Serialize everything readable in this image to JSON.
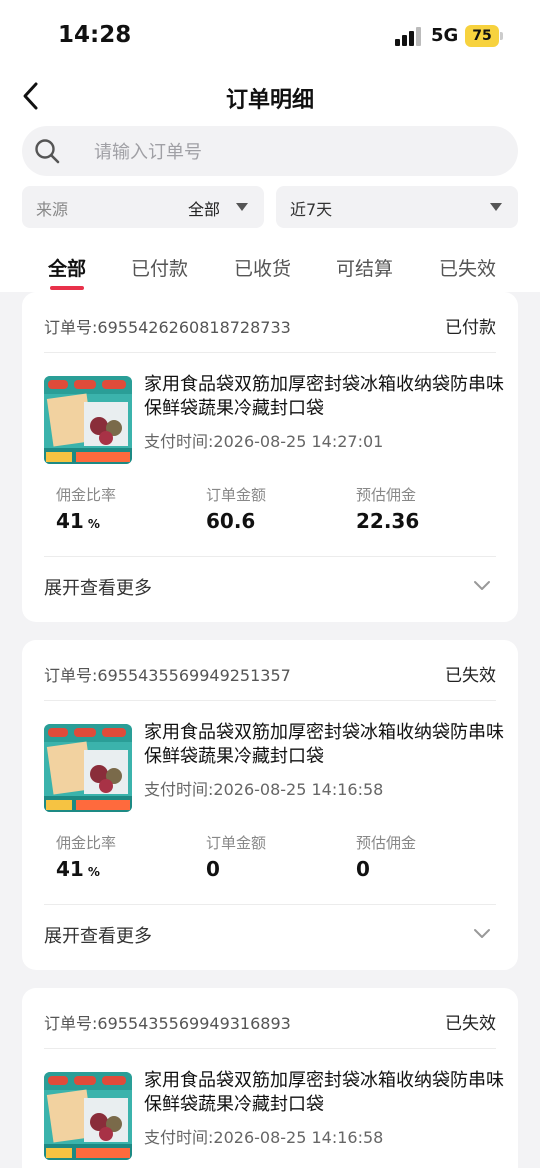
{
  "status_bar": {
    "time": "14:28",
    "network": "5G",
    "battery": "75"
  },
  "nav": {
    "title": "订单明细"
  },
  "search": {
    "placeholder": "请输入订单号"
  },
  "filters": {
    "source": {
      "label": "来源",
      "value": "全部"
    },
    "range": {
      "value": "近7天"
    }
  },
  "tabs": [
    {
      "label": "全部",
      "active": true
    },
    {
      "label": "已付款",
      "active": false
    },
    {
      "label": "已收货",
      "active": false
    },
    {
      "label": "可结算",
      "active": false
    },
    {
      "label": "已失效",
      "active": false
    }
  ],
  "labels": {
    "order_no": "订单号:",
    "pay_time": "支付时间:",
    "commission_rate": "佣金比率",
    "order_amount": "订单金额",
    "est_commission": "预估佣金",
    "percent": "%",
    "expand": "展开查看更多"
  },
  "orders": [
    {
      "order_no": "6955426260818728733",
      "status": "已付款",
      "product": "家用食品袋双筋加厚密封袋冰箱收纳袋防串味保鲜袋蔬果冷藏封口袋",
      "pay_time": "2026-08-25 14:27:01",
      "rate": "41",
      "amount": "60.6",
      "commission": "22.36"
    },
    {
      "order_no": "6955435569949251357",
      "status": "已失效",
      "product": "家用食品袋双筋加厚密封袋冰箱收纳袋防串味保鲜袋蔬果冷藏封口袋",
      "pay_time": "2026-08-25 14:16:58",
      "rate": "41",
      "amount": "0",
      "commission": "0"
    },
    {
      "order_no": "6955435569949316893",
      "status": "已失效",
      "product": "家用食品袋双筋加厚密封袋冰箱收纳袋防串味保鲜袋蔬果冷藏封口袋",
      "pay_time": "2026-08-25 14:16:58"
    }
  ],
  "colors": {
    "accent": "#e8314a",
    "battery": "#f7d23e"
  },
  "icons": {
    "back": "back-arrow-icon",
    "search": "search-icon",
    "expand": "chevron-down-icon"
  }
}
